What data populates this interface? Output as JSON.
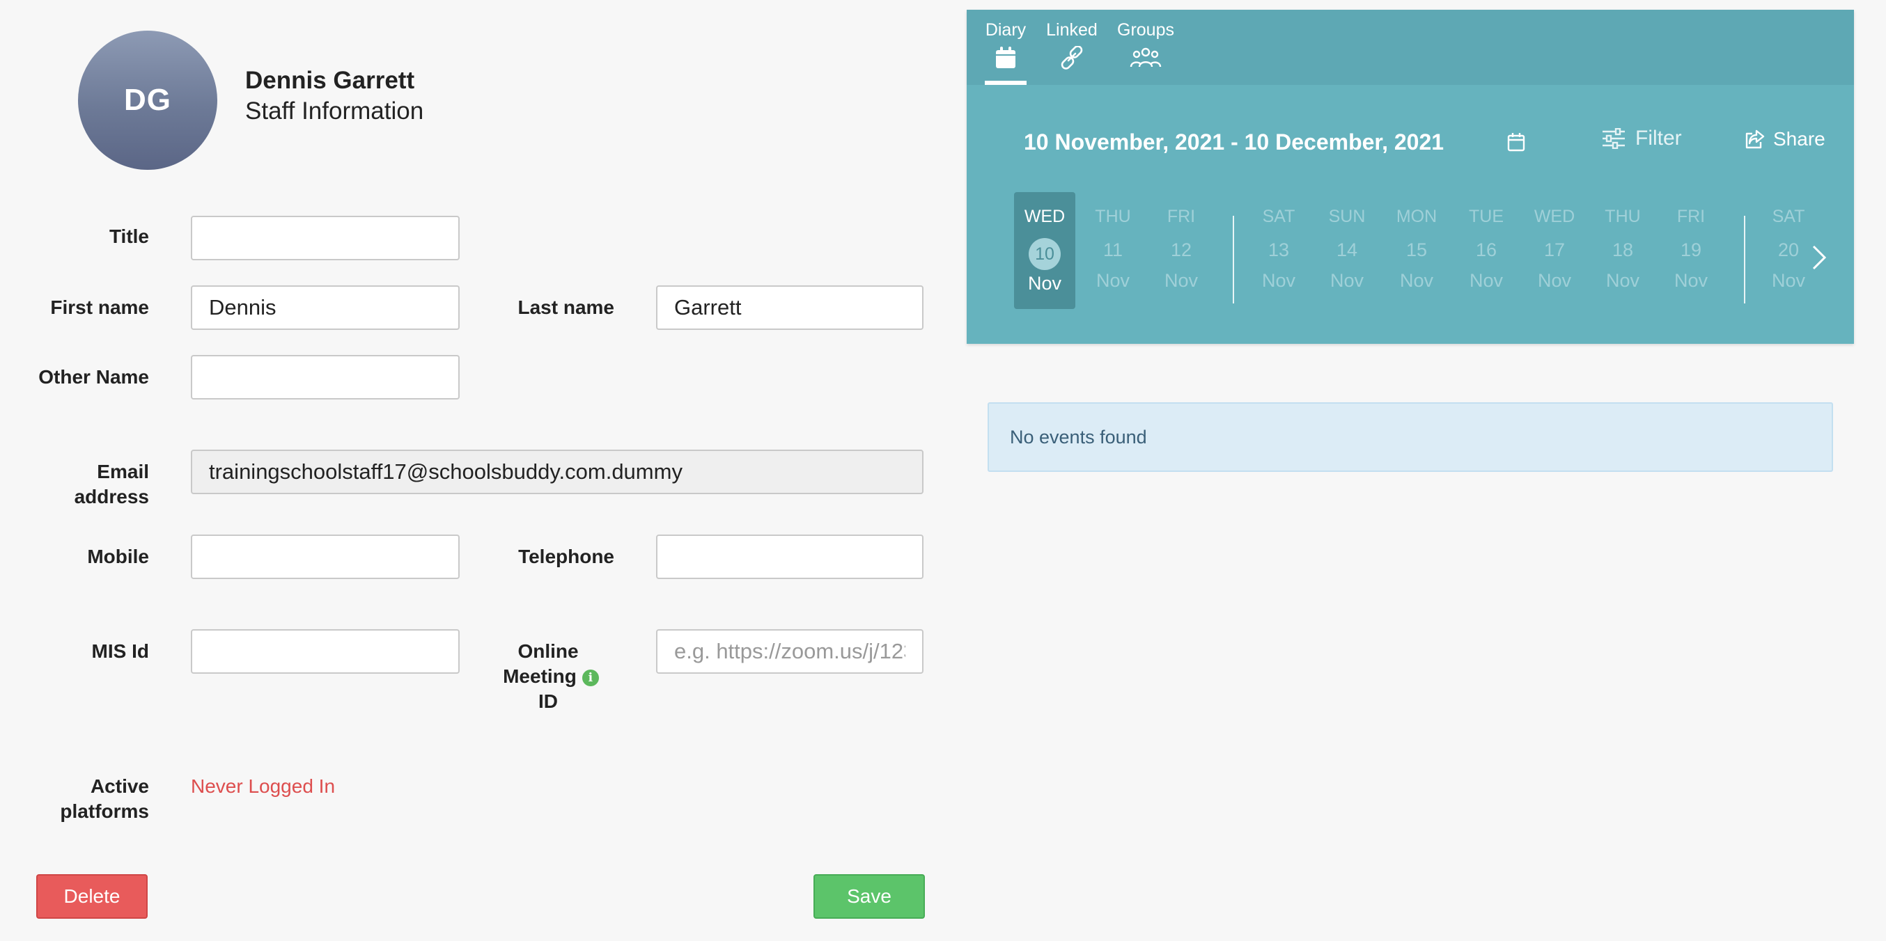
{
  "profile": {
    "initials": "DG",
    "name": "Dennis Garrett",
    "subtitle": "Staff Information"
  },
  "form": {
    "title_label": "Title",
    "title_value": "",
    "first_name_label": "First name",
    "first_name_value": "Dennis",
    "last_name_label": "Last name",
    "last_name_value": "Garrett",
    "other_name_label": "Other Name",
    "other_name_value": "",
    "email_label_line1": "Email",
    "email_label_line2": "address",
    "email_value": "trainingschoolstaff17@schoolsbuddy.com.dummy",
    "mobile_label": "Mobile",
    "mobile_value": "",
    "telephone_label": "Telephone",
    "telephone_value": "",
    "mis_label": "MIS Id",
    "mis_value": "",
    "online_label_line1": "Online",
    "online_label_line2": "Meeting",
    "online_label_line3": "ID",
    "online_placeholder": "e.g. https://zoom.us/j/1234567890",
    "online_value": "",
    "active_label_line1": "Active",
    "active_label_line2": "platforms",
    "active_status": "Never Logged In",
    "delete_label": "Delete",
    "save_label": "Save"
  },
  "panel": {
    "tabs": [
      {
        "label": "Diary",
        "icon": "calendar-icon",
        "active": true
      },
      {
        "label": "Linked",
        "icon": "link-icon",
        "active": false
      },
      {
        "label": "Groups",
        "icon": "groups-icon",
        "active": false
      }
    ],
    "date_range": "10 November, 2021 - 10 December, 2021",
    "filter_label": "Filter",
    "share_label": "Share",
    "days": [
      {
        "dow": "WED",
        "num": "10",
        "mon": "Nov",
        "active": true
      },
      {
        "dow": "THU",
        "num": "11",
        "mon": "Nov"
      },
      {
        "dow": "FRI",
        "num": "12",
        "mon": "Nov"
      },
      {
        "dow": "SAT",
        "num": "13",
        "mon": "Nov"
      },
      {
        "dow": "SUN",
        "num": "14",
        "mon": "Nov"
      },
      {
        "dow": "MON",
        "num": "15",
        "mon": "Nov"
      },
      {
        "dow": "TUE",
        "num": "16",
        "mon": "Nov"
      },
      {
        "dow": "WED",
        "num": "17",
        "mon": "Nov"
      },
      {
        "dow": "THU",
        "num": "18",
        "mon": "Nov"
      },
      {
        "dow": "FRI",
        "num": "19",
        "mon": "Nov"
      },
      {
        "dow": "SAT",
        "num": "20",
        "mon": "Nov"
      }
    ],
    "no_events": "No events found"
  },
  "colors": {
    "panel": "#66b3be",
    "delete": "#e85b5b",
    "save": "#5cc46a",
    "status_error": "#dd4e4e"
  }
}
